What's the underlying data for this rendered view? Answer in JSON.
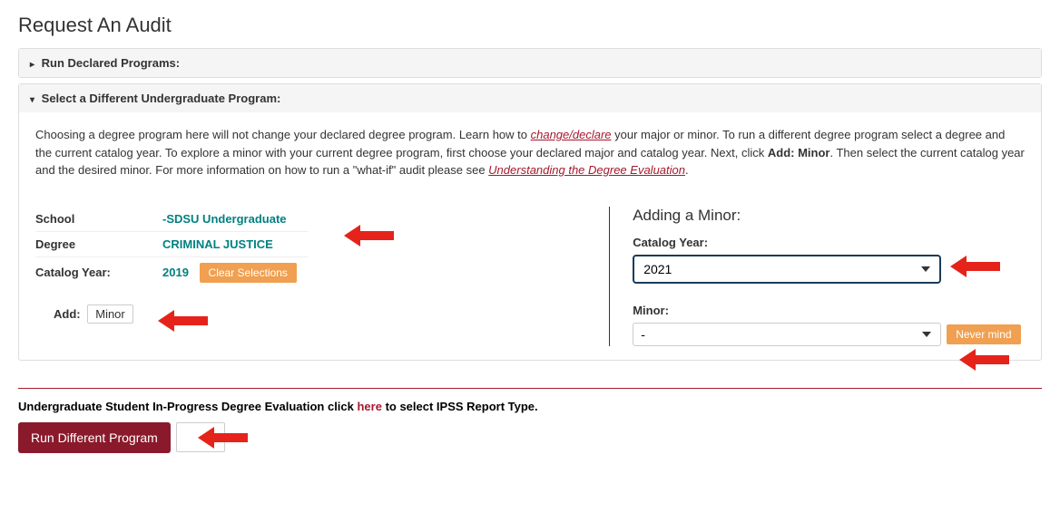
{
  "page_title": "Request An Audit",
  "panel1": {
    "header": "Run Declared Programs:"
  },
  "panel2": {
    "header": "Select a Different Undergraduate Program:",
    "intro_parts": {
      "p1": "Choosing a degree program here will not change your declared degree program. Learn how to ",
      "link1": "change/declare",
      "p2": " your major or minor. To run a different degree program select a degree and the current catalog year. To explore a minor with your current degree program, first choose your declared major and catalog year. Next, click ",
      "bold1": "Add: Minor",
      "p3": ". Then select the current catalog year and the desired minor. For more information on how to run a \"what-if\" audit please see ",
      "link2": "Understanding the Degree Evaluation",
      "p4": "."
    },
    "left": {
      "school_label": "School",
      "school_value": "-SDSU Undergraduate",
      "degree_label": "Degree",
      "degree_value": "CRIMINAL JUSTICE",
      "catalog_label": "Catalog Year:",
      "catalog_value": "2019",
      "clear_btn": "Clear Selections",
      "add_label": "Add:",
      "add_value": "Minor"
    },
    "right": {
      "heading": "Adding a Minor:",
      "catalog_label": "Catalog Year:",
      "catalog_selected": "2021",
      "minor_label": "Minor:",
      "minor_selected": "-",
      "nevermind_btn": "Never mind"
    }
  },
  "footer": {
    "text_p1": "Undergraduate Student In-Progress Degree Evaluation click ",
    "here": "here",
    "text_p2": " to select IPSS Report Type.",
    "run_btn": "Run Different Program"
  }
}
